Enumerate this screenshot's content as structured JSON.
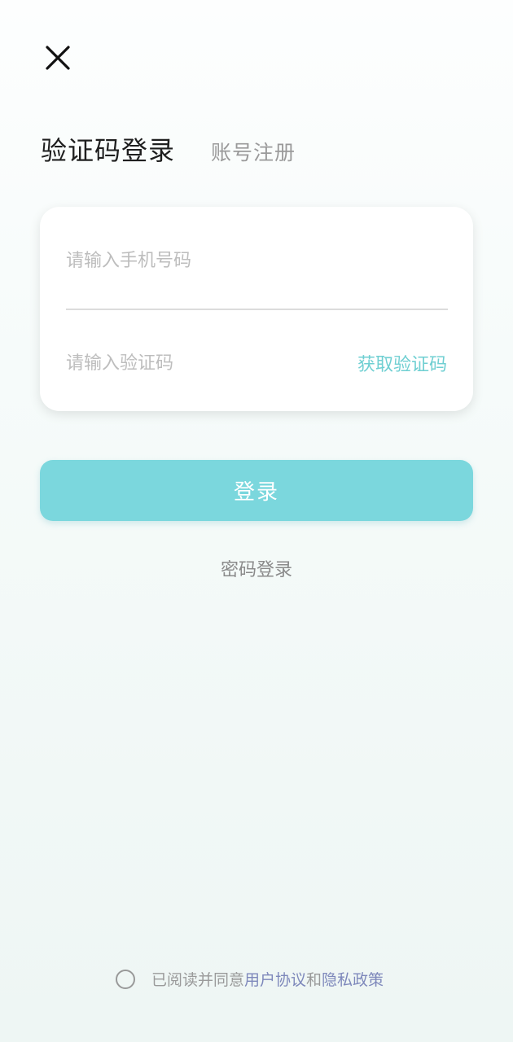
{
  "header": {
    "close_icon": "close-icon"
  },
  "tabs": {
    "active_label": "验证码登录",
    "inactive_label": "账号注册"
  },
  "form": {
    "phone_placeholder": "请输入手机号码",
    "phone_value": "",
    "code_placeholder": "请输入验证码",
    "code_value": "",
    "get_code_label": "获取验证码"
  },
  "actions": {
    "login_label": "登录",
    "password_login_label": "密码登录"
  },
  "agreement": {
    "checked": false,
    "prefix": "已阅读并同意",
    "user_agreement": "用户协议",
    "conjunction": "和",
    "privacy_policy": "隐私政策"
  },
  "colors": {
    "accent": "#7bd7dd",
    "link_teal": "#6fcfd2",
    "link_purple": "#7e88bb",
    "placeholder": "#bdbdbd"
  }
}
